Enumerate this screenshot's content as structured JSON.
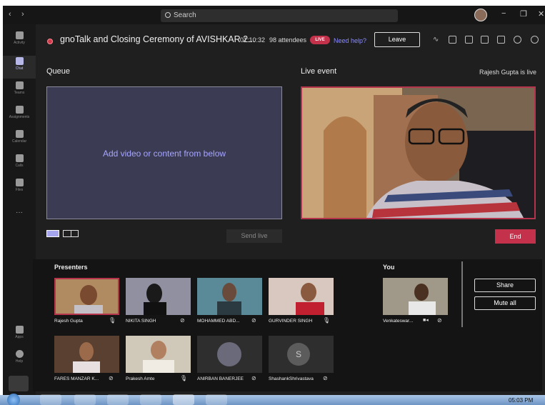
{
  "titlebar": {
    "back_icon": "‹",
    "forward_icon": "›",
    "search_placeholder": "Search",
    "minimize_icon": "−",
    "restore_icon": "❐",
    "close_icon": "✕"
  },
  "rail": {
    "items": [
      {
        "label": "Activity",
        "icon": "bell-icon"
      },
      {
        "label": "Chat",
        "icon": "chat-icon"
      },
      {
        "label": "Teams",
        "icon": "teams-icon"
      },
      {
        "label": "Assignments",
        "icon": "assignments-icon"
      },
      {
        "label": "Calendar",
        "icon": "calendar-icon"
      },
      {
        "label": "Calls",
        "icon": "phone-icon"
      },
      {
        "label": "Files",
        "icon": "files-icon"
      },
      {
        "label": "···",
        "icon": "more-icon"
      },
      {
        "label": "Apps",
        "icon": "apps-icon"
      },
      {
        "label": "Help",
        "icon": "help-icon"
      }
    ]
  },
  "meeting": {
    "title": "gnoTalk and Closing Ceremony of AVISHKAR 2...",
    "duration": "01:10:32",
    "attendees": "98 attendees",
    "live_badge": "LIVE",
    "need_help": "Need help?",
    "leave_label": "Leave"
  },
  "queue": {
    "label": "Queue",
    "placeholder": "Add video or content from below",
    "send_live_label": "Send live"
  },
  "live_event": {
    "label": "Live event",
    "status": "Rajesh Gupta is live",
    "end_label": "End"
  },
  "presenters": {
    "label": "Presenters",
    "tiles": [
      {
        "name": "Rajesh Gupta",
        "mic": "🎙",
        "color": "#6a5848"
      },
      {
        "name": "NIKITA SINGH",
        "mic": "⊘",
        "color": "#4a4a52"
      },
      {
        "name": "MOHAMMED ABD...",
        "mic": "⊘",
        "color": "#4e7888"
      },
      {
        "name": "GURVINDER SINGH",
        "mic": "🎙",
        "color": "#8c5a50"
      },
      {
        "name": "FARES MANZAR K...",
        "mic": "⊘",
        "color": "#705a48"
      },
      {
        "name": "Prakesh Amte",
        "mic": "🎙",
        "color": "#9a8a78"
      },
      {
        "name": "ANIRBAN BANERJEE",
        "mic": "⊘",
        "color": "#3a3838"
      },
      {
        "name": "ShashankShrivastava",
        "mic": "⊘",
        "color": "#3a3a3a",
        "initial": "S"
      }
    ]
  },
  "you": {
    "label": "You",
    "name": "Venkateswar...",
    "camera": "■◂",
    "mic": "⊘",
    "share_label": "Share",
    "mute_all_label": "Mute all"
  },
  "taskbar": {
    "clock": "05:03 PM"
  },
  "colors": {
    "live_red": "#c4314b",
    "accent_purple": "#a6a6ff",
    "queue_bg": "#3c3b54"
  }
}
